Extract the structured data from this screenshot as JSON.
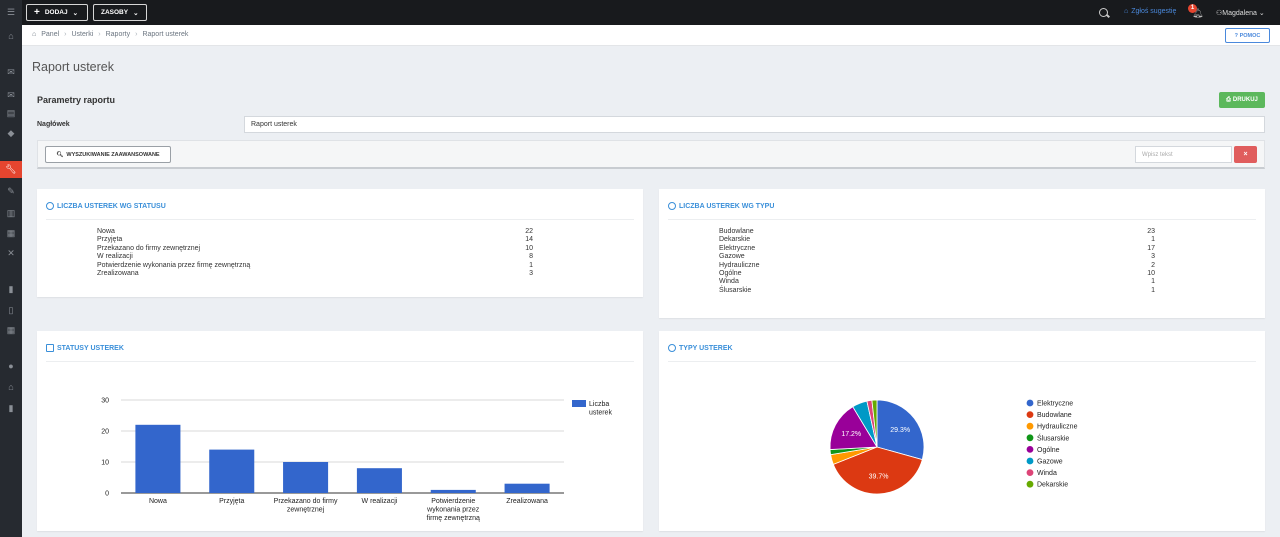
{
  "topbar": {
    "add_label": "DODAJ",
    "resources_label": "ZASOBY",
    "suggest_label": "Zgłoś sugestię",
    "notif_count": "1",
    "user_name": "Magdalena"
  },
  "breadcrumb": {
    "items": [
      "Panel",
      "Usterki",
      "Raporty",
      "Raport usterek"
    ]
  },
  "help_label": "POMOC",
  "page_title": "Raport usterek",
  "params": {
    "title": "Parametry raportu",
    "print_label": "DRUKUJ",
    "header_label": "Nagłówek",
    "header_value": "Raport usterek"
  },
  "search": {
    "advanced_label": "WYSZUKIWANIE ZAAWANSOWANE",
    "placeholder": "Wpisz tekst",
    "clear_label": "×"
  },
  "status_card": {
    "title": "LICZBA USTEREK WG STATUSU",
    "rows": [
      {
        "label": "Nowa",
        "value": "22"
      },
      {
        "label": "Przyjęta",
        "value": "14"
      },
      {
        "label": "Przekazano do firmy zewnętrznej",
        "value": "10"
      },
      {
        "label": "W realizacji",
        "value": "8"
      },
      {
        "label": "Potwierdzenie wykonania przez firmę zewnętrzną",
        "value": "1"
      },
      {
        "label": "Zrealizowana",
        "value": "3"
      }
    ]
  },
  "type_card": {
    "title": "LICZBA USTEREK WG TYPU",
    "rows": [
      {
        "label": "Budowlane",
        "value": "23"
      },
      {
        "label": "Dekarskie",
        "value": "1"
      },
      {
        "label": "Elektryczne",
        "value": "17"
      },
      {
        "label": "Gazowe",
        "value": "3"
      },
      {
        "label": "Hydrauliczne",
        "value": "2"
      },
      {
        "label": "Ogólne",
        "value": "10"
      },
      {
        "label": "Winda",
        "value": "1"
      },
      {
        "label": "Ślusarskie",
        "value": "1"
      }
    ]
  },
  "bar_card_title": "STATUSY USTEREK",
  "pie_card_title": "TYPY USTEREK",
  "chart_data": [
    {
      "type": "bar",
      "categories": [
        "Nowa",
        "Przyjęta",
        "Przekazano do firmy zewnętrznej",
        "W realizacji",
        "Potwierdzenie wykonania przez firmę zewnętrzną",
        "Zrealizowana"
      ],
      "category_lines": [
        [
          "Nowa"
        ],
        [
          "Przyjęta"
        ],
        [
          "Przekazano do firmy",
          "zewnętrznej"
        ],
        [
          "W realizacji"
        ],
        [
          "Potwierdzenie",
          "wykonania przez",
          "firmę zewnętrzną"
        ],
        [
          "Zrealizowana"
        ]
      ],
      "series": [
        {
          "name": "Liczba usterek",
          "values": [
            22,
            14,
            10,
            8,
            1,
            3
          ],
          "color": "#3366cc"
        }
      ],
      "legend_lines": [
        "Liczba",
        "usterek"
      ],
      "ylim": [
        0,
        30
      ],
      "yticks": [
        0,
        10,
        20,
        30
      ],
      "grid": true,
      "legend": "right"
    },
    {
      "type": "pie",
      "labels": [
        "Elektryczne",
        "Budowlane",
        "Hydrauliczne",
        "Ślusarskie",
        "Ogólne",
        "Gazowe",
        "Winda",
        "Dekarskie"
      ],
      "values": [
        17,
        23,
        2,
        1,
        10,
        3,
        1,
        1
      ],
      "colors": [
        "#3366cc",
        "#dc3912",
        "#ff9900",
        "#109618",
        "#990099",
        "#0099c6",
        "#dd4477",
        "#66aa00"
      ],
      "slice_labels": [
        "29.3%",
        "39.7%",
        "",
        "",
        "17.2%",
        "",
        "",
        ""
      ],
      "legend": "right"
    }
  ]
}
